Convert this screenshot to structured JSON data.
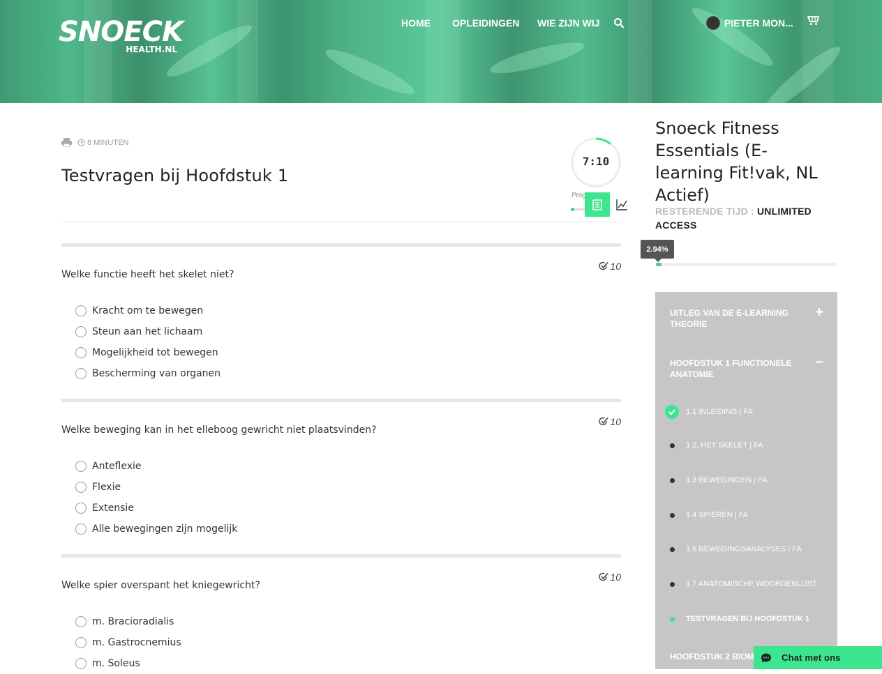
{
  "brand": {
    "name": "SNOECK",
    "domain": "HEALTH.NL",
    "accent": "#3ee58f"
  },
  "nav": {
    "items": [
      {
        "label": "HOME"
      },
      {
        "label": "OPLEIDINGEN"
      },
      {
        "label": "WIE ZIJN WIJ"
      }
    ],
    "search_icon": "search-icon",
    "user_name": "PIETER MON...",
    "cart_icon": "cart-icon"
  },
  "lesson": {
    "duration": "8 MINUTEN",
    "title": "Testvragen bij Hoofdstuk 1",
    "timer": "7:10",
    "progress_label": "Prog"
  },
  "questions": [
    {
      "text": "Welke functie heeft het skelet niet?",
      "points": "10",
      "options": [
        "Kracht om te bewegen",
        "Steun aan het lichaam",
        "Mogelijkheid tot bewegen",
        "Bescherming van organen"
      ]
    },
    {
      "text": "Welke beweging kan in het elleboog gewricht niet plaatsvinden?",
      "points": "10",
      "options": [
        "Anteflexie",
        "Flexie",
        "Extensie",
        "Alle bewegingen zijn mogelijk"
      ]
    },
    {
      "text": "Welke spier overspant het kniegewricht?",
      "points": "10",
      "options": [
        "m. Bracioradialis",
        "m. Gastrocnemius",
        "m. Soleus"
      ]
    }
  ],
  "course": {
    "title": "Snoeck Fitness Essentials (E-learning Fit!vak, NL Actief)",
    "remaining_label": "RESTERENDE TIJD :",
    "remaining_value": "UNLIMITED ACCESS",
    "progress_text": "2.94%",
    "progress_fraction": 0.0294
  },
  "curriculum": {
    "sections": [
      {
        "title": "UITLEG VAN DE E-LEARNING THEORIE",
        "toggle": "+"
      },
      {
        "title": "HOOFDSTUK 1 FUNCTIONELE ANATOMIE",
        "toggle": "−"
      },
      {
        "title": "HOOFDSTUK 2 BIOME"
      }
    ],
    "lessons": [
      {
        "title": "1.1 INLEIDING | FA",
        "state": "completed"
      },
      {
        "title": "1.2. HET SKELET | FA",
        "state": "todo"
      },
      {
        "title": "1.3 BEWEGINGEN | FA",
        "state": "todo"
      },
      {
        "title": "1.4 SPIEREN | FA",
        "state": "todo"
      },
      {
        "title": "1.6 BEWEGINGSANALYSES | FA",
        "state": "todo"
      },
      {
        "title": "1.7 ANATOMISCHE WOORDENLIJST",
        "state": "todo"
      },
      {
        "title": "TESTVRAGEN BIJ HOOFDSTUK 1",
        "state": "current"
      }
    ]
  },
  "chat": {
    "label": "Chat met ons"
  }
}
